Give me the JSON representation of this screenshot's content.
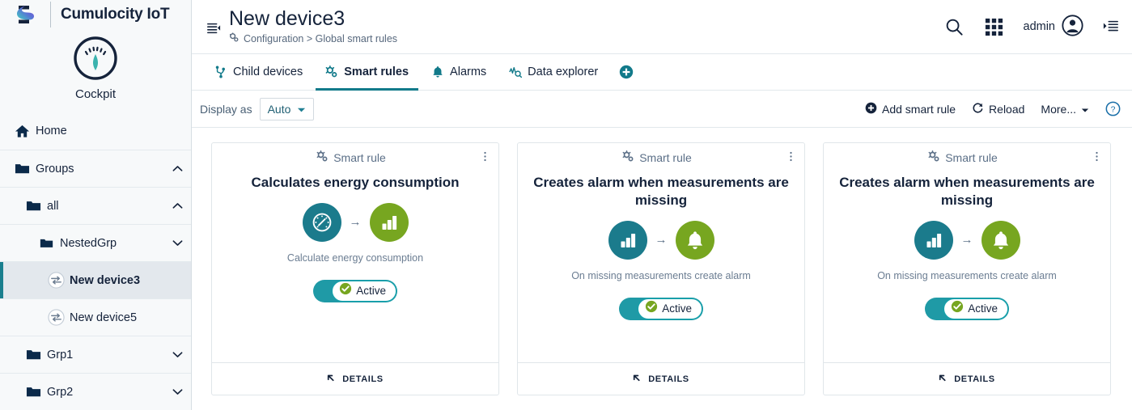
{
  "sidebar": {
    "brand": {
      "title": "Cumulocity IoT",
      "logo_icon": "cumulocity-logo"
    },
    "app": {
      "name": "Cockpit",
      "icon": "gauge-icon"
    },
    "items": [
      {
        "label": "Home",
        "icon": "home-icon",
        "depth": 0,
        "caret": "",
        "active": false,
        "bold": false
      },
      {
        "label": "Groups",
        "icon": "folder-icon",
        "depth": 0,
        "caret": "up",
        "active": false,
        "bold": false
      },
      {
        "label": "all",
        "icon": "folder-icon",
        "depth": 1,
        "caret": "up",
        "active": false,
        "bold": false
      },
      {
        "label": "NestedGrp",
        "icon": "folder-icon",
        "depth": 2,
        "caret": "down",
        "active": false,
        "bold": false
      },
      {
        "label": "New device3",
        "icon": "device-icon",
        "depth": 3,
        "caret": "",
        "active": true,
        "bold": true
      },
      {
        "label": "New device5",
        "icon": "device-icon",
        "depth": 3,
        "caret": "",
        "active": false,
        "bold": false
      },
      {
        "label": "Grp1",
        "icon": "folder-icon",
        "depth": 1,
        "caret": "down",
        "active": false,
        "bold": false
      },
      {
        "label": "Grp2",
        "icon": "folder-icon",
        "depth": 1,
        "caret": "down",
        "active": false,
        "bold": false
      }
    ]
  },
  "header": {
    "collapse_icon": "collapse-sidebar-icon",
    "title": "New device3",
    "breadcrumb_icon": "smart-rule-icon",
    "breadcrumb": "Configuration > Global smart rules",
    "search_icon": "search-icon",
    "apps_icon": "app-switcher-icon",
    "user_name": "admin",
    "user_icon": "user-avatar-icon",
    "right_panel_icon": "right-drawer-icon"
  },
  "tabs": {
    "items": [
      {
        "label": "Child devices",
        "icon": "child-devices-icon",
        "active": false
      },
      {
        "label": "Smart rules",
        "icon": "smart-rule-icon",
        "active": true
      },
      {
        "label": "Alarms",
        "icon": "bell-icon",
        "active": false
      },
      {
        "label": "Data explorer",
        "icon": "data-explorer-icon",
        "active": false
      }
    ],
    "add_icon": "plus-circle-icon"
  },
  "toolbar": {
    "display_as_label": "Display as",
    "display_as_value": "Auto",
    "display_as_caret_icon": "chevron-down-icon",
    "add_smart_rule": "Add smart rule",
    "add_icon": "plus-circle-icon",
    "reload": "Reload",
    "reload_icon": "refresh-icon",
    "more": "More...",
    "more_caret_icon": "caret-down-icon",
    "help_icon": "help-circle-icon"
  },
  "colors": {
    "teal": "#1B7B8C",
    "green": "#77A620",
    "toggle_track": "#1f9aa6",
    "accent": "#127a8a",
    "navy": "#15233b"
  },
  "cards": [
    {
      "head_label": "Smart rule",
      "head_icon": "smart-rule-icon",
      "kebab_icon": "kebab-menu-icon",
      "title": "Calculates energy consumption",
      "source_icon": "gauge-icon",
      "target_icon": "bar-chart-icon",
      "arrow": "→",
      "description": "Calculate energy consumption",
      "toggle_state": "Active",
      "toggle_check_icon": "check-circle-icon",
      "footer_label": "DETAILS",
      "footer_icon": "collapse-caret-icon"
    },
    {
      "head_label": "Smart rule",
      "head_icon": "smart-rule-icon",
      "kebab_icon": "kebab-menu-icon",
      "title": "Creates alarm when measurements are missing",
      "source_icon": "bar-chart-icon",
      "target_icon": "bell-icon",
      "arrow": "→",
      "description": "On missing measurements create alarm",
      "toggle_state": "Active",
      "toggle_check_icon": "check-circle-icon",
      "footer_label": "DETAILS",
      "footer_icon": "collapse-caret-icon"
    },
    {
      "head_label": "Smart rule",
      "head_icon": "smart-rule-icon",
      "kebab_icon": "kebab-menu-icon",
      "title": "Creates alarm when measurements are missing",
      "source_icon": "bar-chart-icon",
      "target_icon": "bell-icon",
      "arrow": "→",
      "description": "On missing measurements create alarm",
      "toggle_state": "Active",
      "toggle_check_icon": "check-circle-icon",
      "footer_label": "DETAILS",
      "footer_icon": "collapse-caret-icon"
    }
  ]
}
